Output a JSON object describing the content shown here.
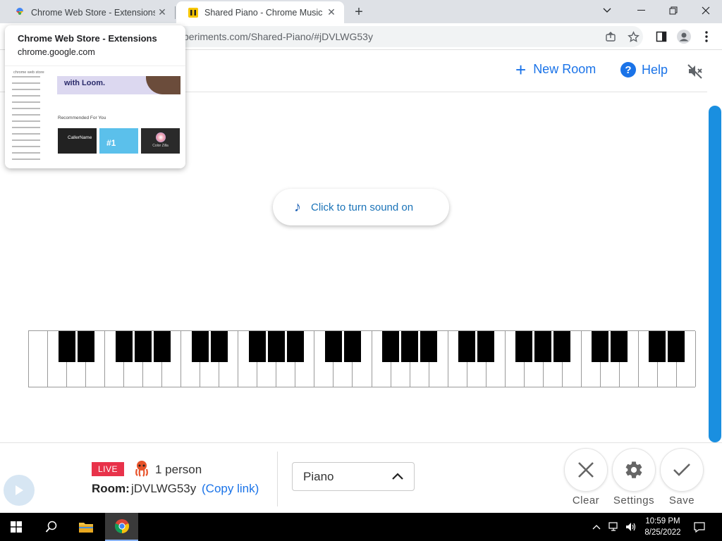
{
  "browser": {
    "tabs": [
      {
        "title": "Chrome Web Store - Extensions",
        "active": false
      },
      {
        "title": "Shared Piano - Chrome Music La",
        "active": true
      }
    ],
    "url": "periments.com/Shared-Piano/#jDVLWG53y",
    "icons": [
      "share-icon",
      "star-icon",
      "sidepanel-icon",
      "profile-icon",
      "kebab-menu-icon"
    ]
  },
  "hovercard": {
    "title": "Chrome Web Store - Extensions",
    "domain": "chrome.google.com",
    "thumb": {
      "store_label": "chrome web store",
      "banner_text": "with Loom.",
      "section": "Recommended For You",
      "cards": [
        "CallerName",
        "#1",
        "Color Zilla"
      ]
    }
  },
  "header": {
    "new_room": "New Room",
    "help": "Help"
  },
  "sound_prompt": "Click to turn sound on",
  "piano": {
    "white_keys": 35,
    "black_keys_per_octave": [
      1,
      2,
      4,
      5,
      6
    ]
  },
  "footer": {
    "live_badge": "LIVE",
    "people": "1 person",
    "room_label": "Room:",
    "room_id": "jDVLWG53y",
    "copy_link": "(Copy link)",
    "instrument": "Piano",
    "clear": "Clear",
    "settings": "Settings",
    "save": "Save"
  },
  "taskbar": {
    "time": "10:59 PM",
    "date": "8/25/2022"
  },
  "colors": {
    "accent": "#1a73e8",
    "live": "#e8324a",
    "scroll": "#1a8fe0"
  }
}
